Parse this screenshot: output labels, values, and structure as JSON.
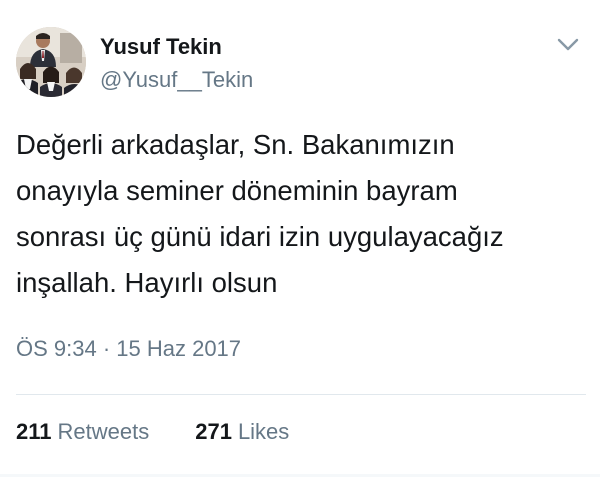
{
  "author": {
    "display_name": "Yusuf Tekin",
    "handle": "@Yusuf__Tekin",
    "avatar_icon": "profile-photo"
  },
  "menu": {
    "icon": "chevron-down-icon"
  },
  "tweet": {
    "lines": [
      "Değerli arkadaşlar, Sn. Bakanımızın",
      "onayıyla seminer döneminin bayram",
      "sonrası üç günü idari izin uygulayacağız",
      "inşallah. Hayırlı olsun"
    ],
    "timestamp": "ÖS 9:34 · 15 Haz 2017"
  },
  "stats": {
    "retweets_count": "211",
    "retweets_label": "Retweets",
    "likes_count": "271",
    "likes_label": "Likes"
  },
  "colors": {
    "primary_text": "#14171a",
    "secondary_text": "#657786",
    "divider": "#e1e8ed"
  }
}
